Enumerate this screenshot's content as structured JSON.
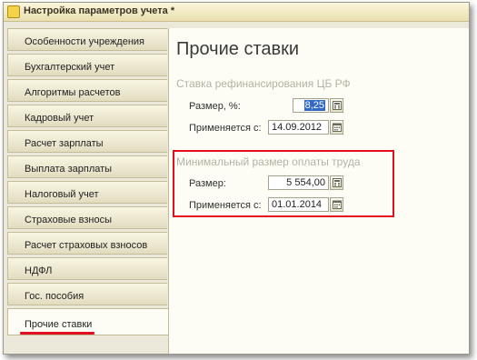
{
  "window": {
    "title": "Настройка параметров учета *"
  },
  "sidebar": {
    "items": [
      {
        "label": "Особенности учреждения"
      },
      {
        "label": "Бухгалтерский учет"
      },
      {
        "label": "Алгоритмы расчетов"
      },
      {
        "label": "Кадровый учет"
      },
      {
        "label": "Расчет зарплаты"
      },
      {
        "label": "Выплата зарплаты"
      },
      {
        "label": "Налоговый учет"
      },
      {
        "label": "Страховые взносы"
      },
      {
        "label": "Расчет страховых взносов"
      },
      {
        "label": "НДФЛ"
      },
      {
        "label": "Гос. пособия"
      },
      {
        "label": "Прочие ставки"
      }
    ],
    "active": "Прочие ставки"
  },
  "main": {
    "heading": "Прочие ставки",
    "refinancing": {
      "title": "Ставка рефинансирования ЦБ РФ",
      "size_label": "Размер, %:",
      "size_value": "8,25",
      "applied_label": "Применяется с:",
      "applied_value": "14.09.2012"
    },
    "min_wage": {
      "title": "Минимальный размер оплаты труда",
      "size_label": "Размер:",
      "size_value": "5 554,00",
      "applied_label": "Применяется с:",
      "applied_value": "01.01.2014"
    }
  },
  "colors": {
    "highlight_red": "#e0101e",
    "selection_blue": "#3169c6"
  },
  "icons": {
    "calendar": "calendar-icon",
    "calculator": "calculator-icon"
  }
}
